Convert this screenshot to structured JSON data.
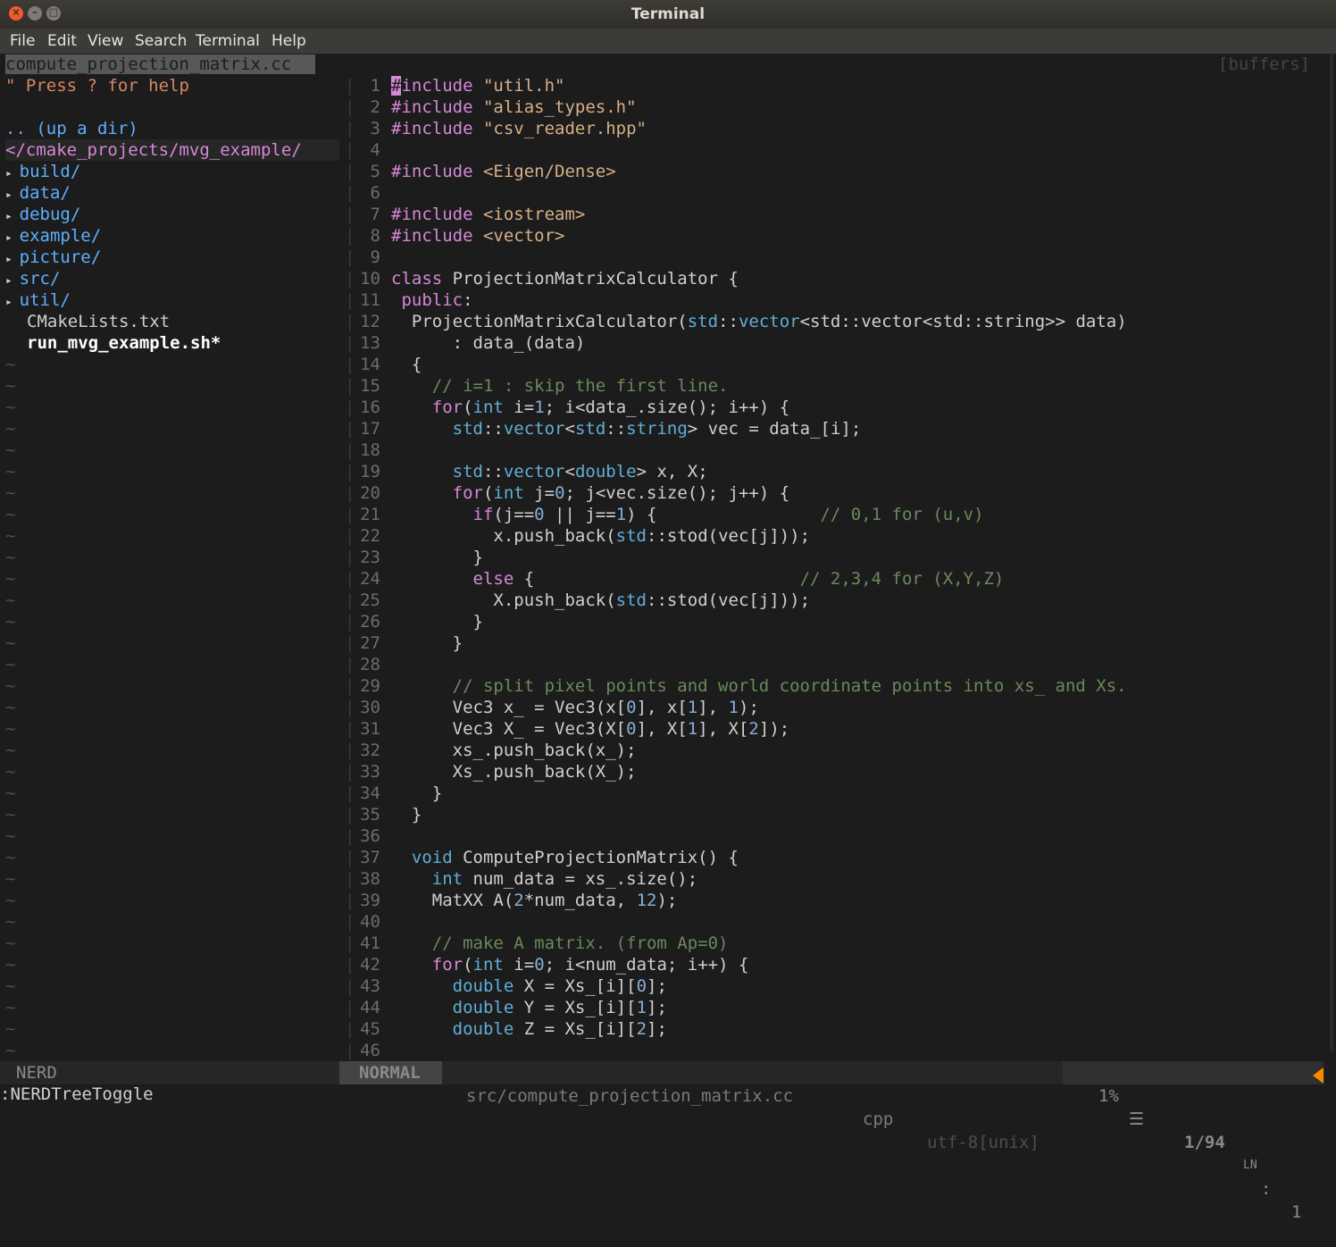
{
  "window": {
    "title": "Terminal"
  },
  "menu": [
    "File",
    "Edit",
    "View",
    "Search",
    "Terminal",
    "Help"
  ],
  "nerdtree": {
    "tab_label": "compute_projection_matrix.cc",
    "help": "\" Press ? for help",
    "up_dir": ".. (up a dir)",
    "cwd": "</cmake_projects/mvg_example/",
    "dirs": [
      "build/",
      "data/",
      "debug/",
      "example/",
      "picture/",
      "src/",
      "util/"
    ],
    "files": [
      "CMakeLists.txt"
    ],
    "exec_files": [
      "run_mvg_example.sh*"
    ],
    "status": "NERD"
  },
  "buffers_label": "[buffers]",
  "editor": {
    "lines": [
      {
        "n": "1",
        "t": [
          [
            "pp",
            "#include "
          ],
          [
            "str",
            "\"util.h\""
          ]
        ]
      },
      {
        "n": "2",
        "t": [
          [
            "pp",
            "#include "
          ],
          [
            "str",
            "\"alias_types.h\""
          ]
        ]
      },
      {
        "n": "3",
        "t": [
          [
            "pp",
            "#include "
          ],
          [
            "str",
            "\"csv_reader.hpp\""
          ]
        ]
      },
      {
        "n": "4",
        "t": []
      },
      {
        "n": "5",
        "t": [
          [
            "pp",
            "#include "
          ],
          [
            "str",
            "<Eigen/Dense>"
          ]
        ]
      },
      {
        "n": "6",
        "t": []
      },
      {
        "n": "7",
        "t": [
          [
            "pp",
            "#include "
          ],
          [
            "str",
            "<iostream>"
          ]
        ]
      },
      {
        "n": "8",
        "t": [
          [
            "pp",
            "#include "
          ],
          [
            "str",
            "<vector>"
          ]
        ]
      },
      {
        "n": "9",
        "t": []
      },
      {
        "n": "10",
        "t": [
          [
            "ctl",
            "class "
          ],
          [
            "plain",
            "ProjectionMatrixCalculator {"
          ]
        ]
      },
      {
        "n": "11",
        "t": [
          [
            "ctl",
            " public"
          ],
          [
            "plain",
            ":"
          ]
        ]
      },
      {
        "n": "12",
        "t": [
          [
            "plain",
            "  ProjectionMatrixCalculator("
          ],
          [
            "typ",
            "std"
          ],
          [
            "plain",
            "::"
          ],
          [
            "typ",
            "vector"
          ],
          [
            "plain",
            "<std::vector<std::string>> data)"
          ]
        ]
      },
      {
        "n": "13",
        "t": [
          [
            "plain",
            "      : data_(data)"
          ]
        ]
      },
      {
        "n": "14",
        "t": [
          [
            "plain",
            "  {"
          ]
        ]
      },
      {
        "n": "15",
        "t": [
          [
            "cmt",
            "    // i=1 : skip the first line."
          ]
        ]
      },
      {
        "n": "16",
        "t": [
          [
            "ctl",
            "    for"
          ],
          [
            "plain",
            "("
          ],
          [
            "typ",
            "int"
          ],
          [
            "plain",
            " i="
          ],
          [
            "num",
            "1"
          ],
          [
            "plain",
            "; i<data_.size(); i++) {"
          ]
        ]
      },
      {
        "n": "17",
        "t": [
          [
            "typ",
            "      std"
          ],
          [
            "plain",
            "::"
          ],
          [
            "typ",
            "vector"
          ],
          [
            "plain",
            "<"
          ],
          [
            "typ",
            "std"
          ],
          [
            "plain",
            "::"
          ],
          [
            "typ",
            "string"
          ],
          [
            "plain",
            "> vec = data_[i];"
          ]
        ]
      },
      {
        "n": "18",
        "t": []
      },
      {
        "n": "19",
        "t": [
          [
            "typ",
            "      std"
          ],
          [
            "plain",
            "::"
          ],
          [
            "typ",
            "vector"
          ],
          [
            "plain",
            "<"
          ],
          [
            "typ",
            "double"
          ],
          [
            "plain",
            "> x, X;"
          ]
        ]
      },
      {
        "n": "20",
        "t": [
          [
            "ctl",
            "      for"
          ],
          [
            "plain",
            "("
          ],
          [
            "typ",
            "int"
          ],
          [
            "plain",
            " j="
          ],
          [
            "num",
            "0"
          ],
          [
            "plain",
            "; j<vec.size(); j++) {"
          ]
        ]
      },
      {
        "n": "21",
        "t": [
          [
            "ctl",
            "        if"
          ],
          [
            "plain",
            "(j=="
          ],
          [
            "num",
            "0"
          ],
          [
            "plain",
            " || j=="
          ],
          [
            "num",
            "1"
          ],
          [
            "plain",
            ") {                "
          ],
          [
            "cmt",
            "// 0,1 for (u,v)"
          ]
        ]
      },
      {
        "n": "22",
        "t": [
          [
            "plain",
            "          x.push_back("
          ],
          [
            "typ",
            "std"
          ],
          [
            "plain",
            "::stod(vec[j]));"
          ]
        ]
      },
      {
        "n": "23",
        "t": [
          [
            "plain",
            "        }"
          ]
        ]
      },
      {
        "n": "24",
        "t": [
          [
            "ctl",
            "        else"
          ],
          [
            "plain",
            " {                          "
          ],
          [
            "cmt",
            "// 2,3,4 for (X,Y,Z)"
          ]
        ]
      },
      {
        "n": "25",
        "t": [
          [
            "plain",
            "          X.push_back("
          ],
          [
            "typ",
            "std"
          ],
          [
            "plain",
            "::stod(vec[j]));"
          ]
        ]
      },
      {
        "n": "26",
        "t": [
          [
            "plain",
            "        }"
          ]
        ]
      },
      {
        "n": "27",
        "t": [
          [
            "plain",
            "      }"
          ]
        ]
      },
      {
        "n": "28",
        "t": []
      },
      {
        "n": "29",
        "t": [
          [
            "cmt",
            "      // split pixel points and world coordinate points into xs_ and Xs."
          ]
        ]
      },
      {
        "n": "30",
        "t": [
          [
            "plain",
            "      Vec3 x_ = Vec3(x["
          ],
          [
            "num",
            "0"
          ],
          [
            "plain",
            "], x["
          ],
          [
            "num",
            "1"
          ],
          [
            "plain",
            "], "
          ],
          [
            "num",
            "1"
          ],
          [
            "plain",
            ");"
          ]
        ]
      },
      {
        "n": "31",
        "t": [
          [
            "plain",
            "      Vec3 X_ = Vec3(X["
          ],
          [
            "num",
            "0"
          ],
          [
            "plain",
            "], X["
          ],
          [
            "num",
            "1"
          ],
          [
            "plain",
            "], X["
          ],
          [
            "num",
            "2"
          ],
          [
            "plain",
            "]);"
          ]
        ]
      },
      {
        "n": "32",
        "t": [
          [
            "plain",
            "      xs_.push_back(x_);"
          ]
        ]
      },
      {
        "n": "33",
        "t": [
          [
            "plain",
            "      Xs_.push_back(X_);"
          ]
        ]
      },
      {
        "n": "34",
        "t": [
          [
            "plain",
            "    }"
          ]
        ]
      },
      {
        "n": "35",
        "t": [
          [
            "plain",
            "  }"
          ]
        ]
      },
      {
        "n": "36",
        "t": []
      },
      {
        "n": "37",
        "t": [
          [
            "typ",
            "  void"
          ],
          [
            "plain",
            " ComputeProjectionMatrix() {"
          ]
        ]
      },
      {
        "n": "38",
        "t": [
          [
            "typ",
            "    int"
          ],
          [
            "plain",
            " num_data = xs_.size();"
          ]
        ]
      },
      {
        "n": "39",
        "t": [
          [
            "plain",
            "    MatXX A("
          ],
          [
            "num",
            "2"
          ],
          [
            "plain",
            "*num_data, "
          ],
          [
            "num",
            "12"
          ],
          [
            "plain",
            ");"
          ]
        ]
      },
      {
        "n": "40",
        "t": []
      },
      {
        "n": "41",
        "t": [
          [
            "cmt",
            "    // make A matrix. (from Ap=0)"
          ]
        ]
      },
      {
        "n": "42",
        "t": [
          [
            "ctl",
            "    for"
          ],
          [
            "plain",
            "("
          ],
          [
            "typ",
            "int"
          ],
          [
            "plain",
            " i="
          ],
          [
            "num",
            "0"
          ],
          [
            "plain",
            "; i<num_data; i++) {"
          ]
        ]
      },
      {
        "n": "43",
        "t": [
          [
            "typ",
            "      double"
          ],
          [
            "plain",
            " X = Xs_[i]["
          ],
          [
            "num",
            "0"
          ],
          [
            "plain",
            "];"
          ]
        ]
      },
      {
        "n": "44",
        "t": [
          [
            "typ",
            "      double"
          ],
          [
            "plain",
            " Y = Xs_[i]["
          ],
          [
            "num",
            "1"
          ],
          [
            "plain",
            "];"
          ]
        ]
      },
      {
        "n": "45",
        "t": [
          [
            "typ",
            "      double"
          ],
          [
            "plain",
            " Z = Xs_[i]["
          ],
          [
            "num",
            "2"
          ],
          [
            "plain",
            "];"
          ]
        ]
      },
      {
        "n": "46",
        "t": []
      }
    ]
  },
  "statusline": {
    "mode": "NORMAL",
    "file": "src/compute_projection_matrix.cc",
    "filetype": "cpp",
    "encoding": "utf-8[unix]",
    "percent": "1%",
    "position": "1/94",
    "column": "1"
  },
  "cmdline": ":NERDTreeToggle",
  "colors": {
    "accent": "#ff8700",
    "background": "#1c1c1c",
    "directory": "#5fafff",
    "keyword": "#d787d7"
  }
}
